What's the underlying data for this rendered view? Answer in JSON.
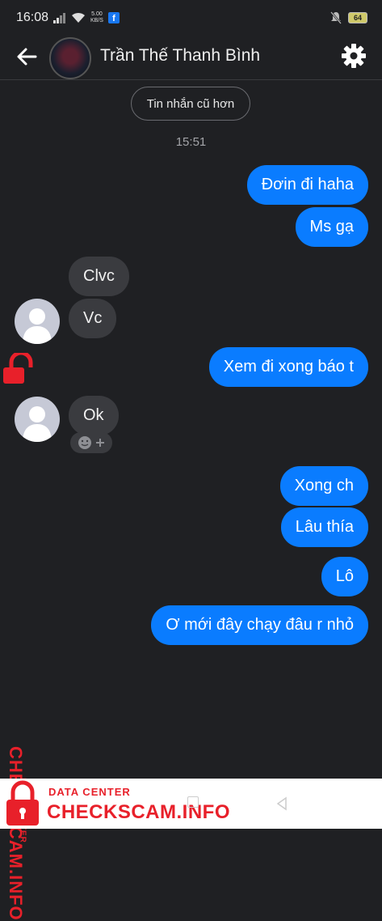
{
  "status_bar": {
    "time": "16:08",
    "speed_value": "5.00",
    "speed_unit": "KB/S",
    "fb_glyph": "f",
    "battery": "64"
  },
  "header": {
    "contact_name": "Trần Thế Thanh Bình",
    "back_icon": "arrow-left-icon",
    "settings_icon": "gear-icon"
  },
  "chat": {
    "older_messages_label": "Tin nhắn cũ hơn",
    "timestamp": "15:51",
    "messages": [
      {
        "direction": "outgoing",
        "text": "Đơin đi haha"
      },
      {
        "direction": "outgoing",
        "text": "Ms gạ"
      },
      {
        "direction": "incoming",
        "text": "Clvc"
      },
      {
        "direction": "incoming",
        "text": "Vc"
      },
      {
        "direction": "outgoing",
        "text": "Xem đi xong báo t"
      },
      {
        "direction": "incoming",
        "text": "Ok"
      },
      {
        "direction": "outgoing",
        "text": "Xong ch"
      },
      {
        "direction": "outgoing",
        "text": "Lâu thía"
      },
      {
        "direction": "outgoing",
        "text": "Lô"
      },
      {
        "direction": "outgoing",
        "text": "Ơ mới đây chạy đâu r nhỏ"
      }
    ]
  },
  "watermark": {
    "label_small": "DATA CENTER",
    "label_big": "CHECKSCAM.INFO"
  },
  "colors": {
    "background": "#1f2023",
    "outgoing_bubble": "#0a7cff",
    "incoming_bubble": "#3a3b3f",
    "watermark_red": "#e8202a"
  }
}
